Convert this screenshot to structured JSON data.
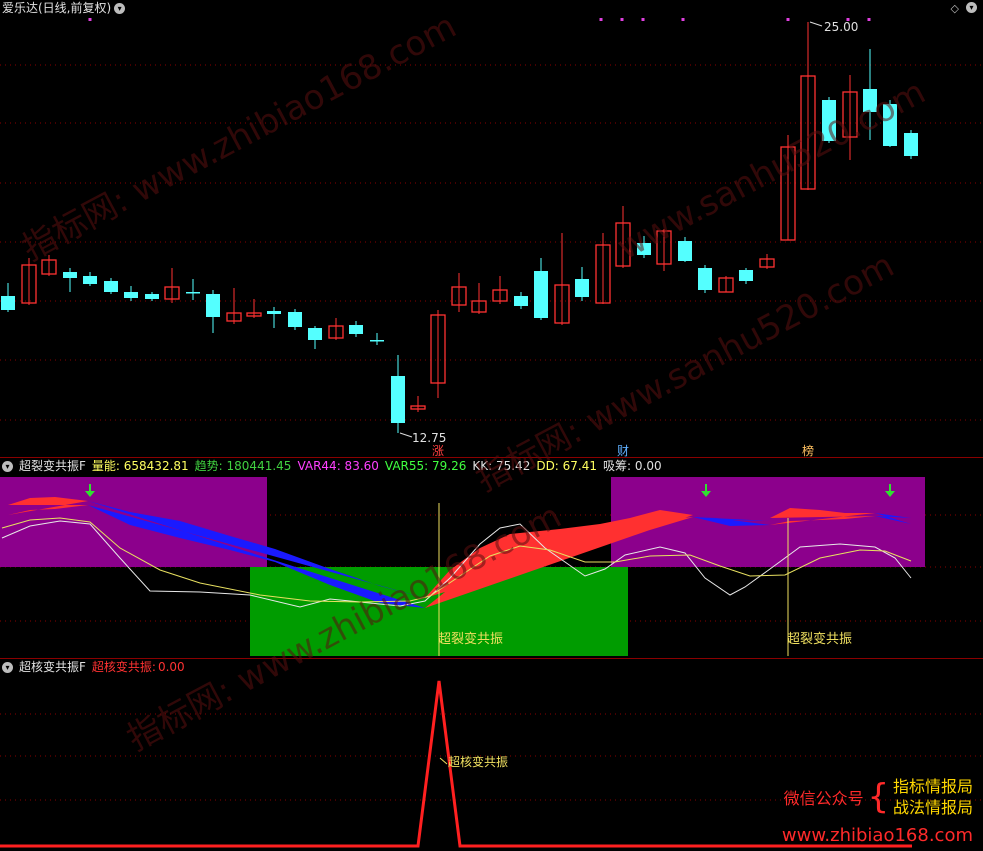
{
  "main": {
    "title": "爱乐达(日线,前复权)",
    "high_label": "25.00",
    "low_label": "12.75",
    "markers": [
      "涨",
      "财",
      "榜"
    ]
  },
  "ind1": {
    "title": "超裂变共振F",
    "fields": [
      {
        "label": "量能:",
        "value": "658432.81",
        "color": "#ffff60"
      },
      {
        "label": "趋势:",
        "value": "180441.45",
        "color": "#40d040"
      },
      {
        "label": "VAR44:",
        "value": "83.60",
        "color": "#ff40ff"
      },
      {
        "label": "VAR55:",
        "value": "79.26",
        "color": "#40ff40"
      },
      {
        "label": "KK:",
        "value": "75.42",
        "color": "#e0e0e0"
      },
      {
        "label": "DD:",
        "value": "67.41",
        "color": "#ffff60"
      },
      {
        "label": "吸筹:",
        "value": "0.00",
        "color": "#e0e0e0"
      }
    ],
    "signal_label_1": "超裂变共振",
    "signal_label_2": "超裂变共振"
  },
  "ind2": {
    "title": "超核变共振F",
    "field_label": "超核变共振:",
    "field_value": "0.00",
    "spike_label": "超核变共振"
  },
  "promo": {
    "wechat": "微信公众号",
    "line1": "指标情报局",
    "line2": "战法情报局",
    "url": "www.zhibiao168.com"
  },
  "watermarks": [
    "指标网: www.zhibiao168.com",
    "www.sanhu520.com",
    "指标网: www.sanhu520.com",
    "指标网: www.zhibiao168.com"
  ],
  "colors": {
    "up": "#ff3232",
    "down": "#54ffff",
    "grid": "#8a0000",
    "purple": "#8c008c",
    "green": "#009c00"
  },
  "icons": [
    "chevron-down-icon",
    "diamond-icon"
  ]
}
